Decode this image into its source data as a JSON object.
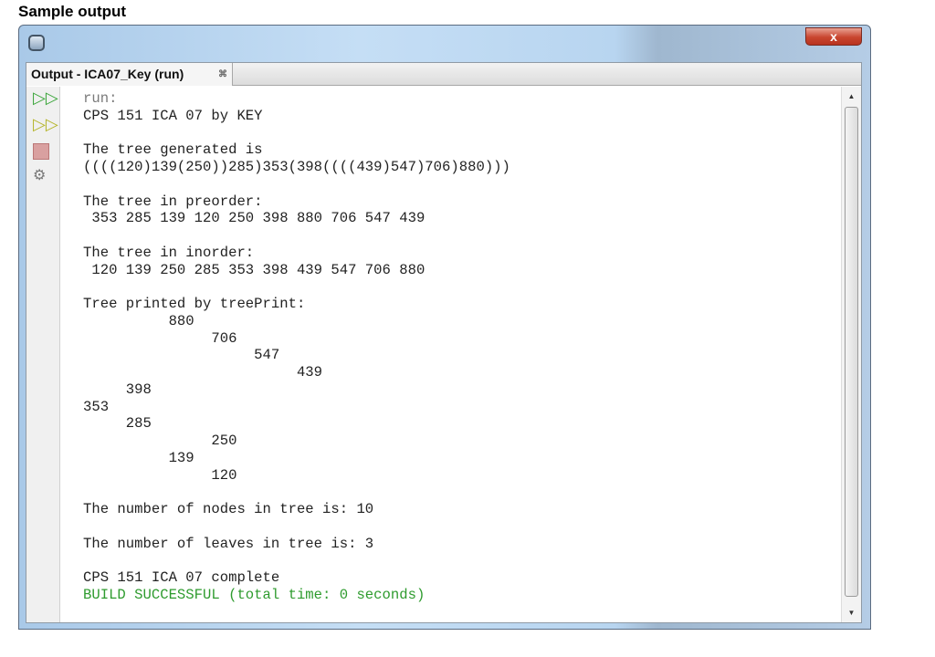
{
  "heading": "Sample output",
  "window": {
    "close_glyph": "x"
  },
  "tab": {
    "label": "Output - ICA07_Key (run)",
    "close_glyph": "⌘"
  },
  "gutter": {
    "icons": [
      "rerun-icon",
      "rerun-with-options-icon",
      "stop-icon",
      "settings-icon"
    ]
  },
  "colors": {
    "run": "#7a7a7a",
    "build": "#2e9b2e",
    "text": "#222222"
  },
  "output": [
    {
      "text": "run:",
      "style": "run"
    },
    {
      "text": "CPS 151 ICA 07 by KEY"
    },
    {
      "text": ""
    },
    {
      "text": "The tree generated is"
    },
    {
      "text": "((((120)139(250))285)353(398((((439)547)706)880)))"
    },
    {
      "text": ""
    },
    {
      "text": "The tree in preorder:"
    },
    {
      "text": " 353 285 139 120 250 398 880 706 547 439"
    },
    {
      "text": ""
    },
    {
      "text": "The tree in inorder:"
    },
    {
      "text": " 120 139 250 285 353 398 439 547 706 880"
    },
    {
      "text": ""
    },
    {
      "text": "Tree printed by treePrint:"
    },
    {
      "text": "          880"
    },
    {
      "text": "               706"
    },
    {
      "text": "                    547"
    },
    {
      "text": "                         439"
    },
    {
      "text": "     398"
    },
    {
      "text": "353"
    },
    {
      "text": "     285"
    },
    {
      "text": "               250"
    },
    {
      "text": "          139"
    },
    {
      "text": "               120"
    },
    {
      "text": ""
    },
    {
      "text": "The number of nodes in tree is: 10"
    },
    {
      "text": ""
    },
    {
      "text": "The number of leaves in tree is: 3"
    },
    {
      "text": ""
    },
    {
      "text": "CPS 151 ICA 07 complete"
    },
    {
      "text": "BUILD SUCCESSFUL (total time: 0 seconds)",
      "style": "build"
    }
  ]
}
